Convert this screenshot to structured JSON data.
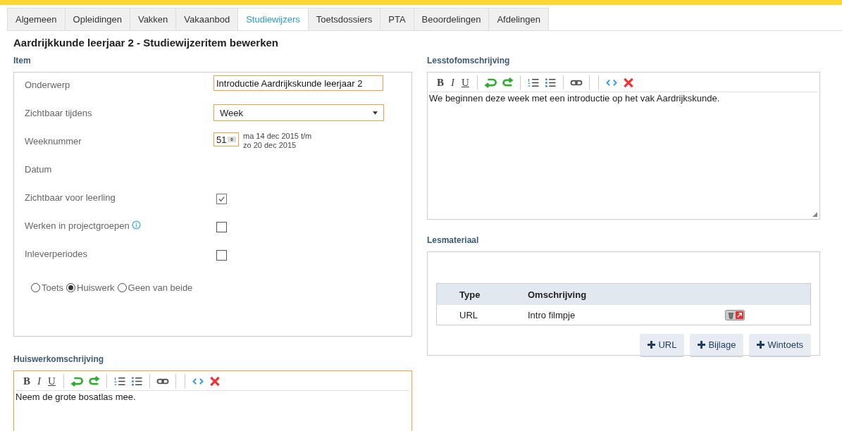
{
  "tabs": [
    {
      "label": "Algemeen",
      "selected": false
    },
    {
      "label": "Opleidingen",
      "selected": false
    },
    {
      "label": "Vakken",
      "selected": false
    },
    {
      "label": "Vakaanbod",
      "selected": false
    },
    {
      "label": "Studiewijzers",
      "selected": true
    },
    {
      "label": "Toetsdossiers",
      "selected": false
    },
    {
      "label": "PTA",
      "selected": false
    },
    {
      "label": "Beoordelingen",
      "selected": false
    },
    {
      "label": "Afdelingen",
      "selected": false
    }
  ],
  "page_title": "Aardrijkkunde leerjaar 2 - Studiewijzeritem bewerken",
  "item": {
    "heading": "Item",
    "rows": [
      {
        "kind": "text",
        "label": "Onderwerp",
        "value": "Introductie Aardrijkskunde leerjaar 2"
      },
      {
        "kind": "select",
        "label": "Zichtbaar tijdens",
        "value": "Week"
      },
      {
        "kind": "week",
        "label": "Weeknummer",
        "value": "51",
        "range": [
          "ma 14 dec 2015 t/m",
          "zo 20 dec 2015"
        ]
      },
      {
        "kind": "empty",
        "label": "Datum"
      },
      {
        "kind": "checkbox",
        "label": "Zichtbaar voor leerling",
        "checked": true,
        "info": false
      },
      {
        "kind": "checkbox",
        "label": "Werken in projectgroepen",
        "checked": false,
        "info": true
      },
      {
        "kind": "checkbox",
        "label": "Inleverperiodes",
        "checked": false,
        "info": false
      }
    ],
    "radios": [
      {
        "label": "Toets",
        "selected": false
      },
      {
        "label": "Huiswerk",
        "selected": true
      },
      {
        "label": "Geen van beide",
        "selected": false
      }
    ]
  },
  "huiswerk": {
    "heading": "Huiswerkomschrijving",
    "toolbar": [
      "B",
      "I",
      "U"
    ],
    "text": "Neem de grote bosatlas mee."
  },
  "lesstof": {
    "heading": "Lesstofomschrijving",
    "toolbar": [
      "B",
      "I",
      "U"
    ],
    "text": "We beginnen deze week met een introductie op het vak Aardrijkskunde."
  },
  "lesmateriaal": {
    "heading": "Lesmateriaal",
    "columns": [
      "Type",
      "Omschrijving"
    ],
    "rows": [
      {
        "type": "URL",
        "description": "Intro filmpje"
      }
    ],
    "buttons": [
      "URL",
      "Bijlage",
      "Wintoets"
    ]
  }
}
